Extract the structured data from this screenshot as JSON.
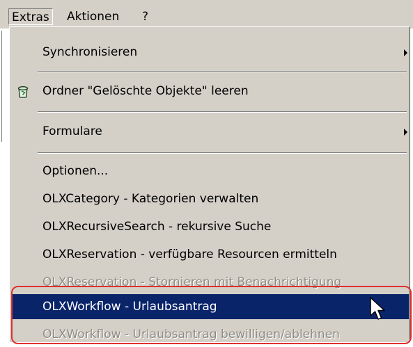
{
  "menubar": {
    "items": [
      {
        "label": "Extras",
        "open": true
      },
      {
        "label": "Aktionen"
      },
      {
        "label": "?"
      }
    ]
  },
  "menu": {
    "items": [
      {
        "label": "Synchronisieren",
        "submenu": true
      },
      {
        "label": "Ordner \"Gelöschte Objekte\" leeren",
        "icon": "recycle-bin-icon"
      },
      {
        "label": "Formulare",
        "submenu": true
      },
      {
        "label": "Optionen..."
      },
      {
        "label": "OLXCategory - Kategorien verwalten"
      },
      {
        "label": "OLXRecursiveSearch - rekursive Suche"
      },
      {
        "label": "OLXReservation - verfügbare Resourcen ermitteln"
      },
      {
        "label": "OLXReservation - Stornieren mit Benachrichtigung",
        "disabled": true
      },
      {
        "label": "OLXWorkflow - Urlaubsantrag",
        "selected": true
      },
      {
        "label": "OLXWorkflow - Urlaubsantrag bewilligen/ablehnen",
        "disabled": true
      }
    ]
  },
  "colors": {
    "menu_bg": "#d4d0c8",
    "selection": "#0a246a",
    "disabled_text": "#8f8c85",
    "annotation": "#e03030"
  }
}
